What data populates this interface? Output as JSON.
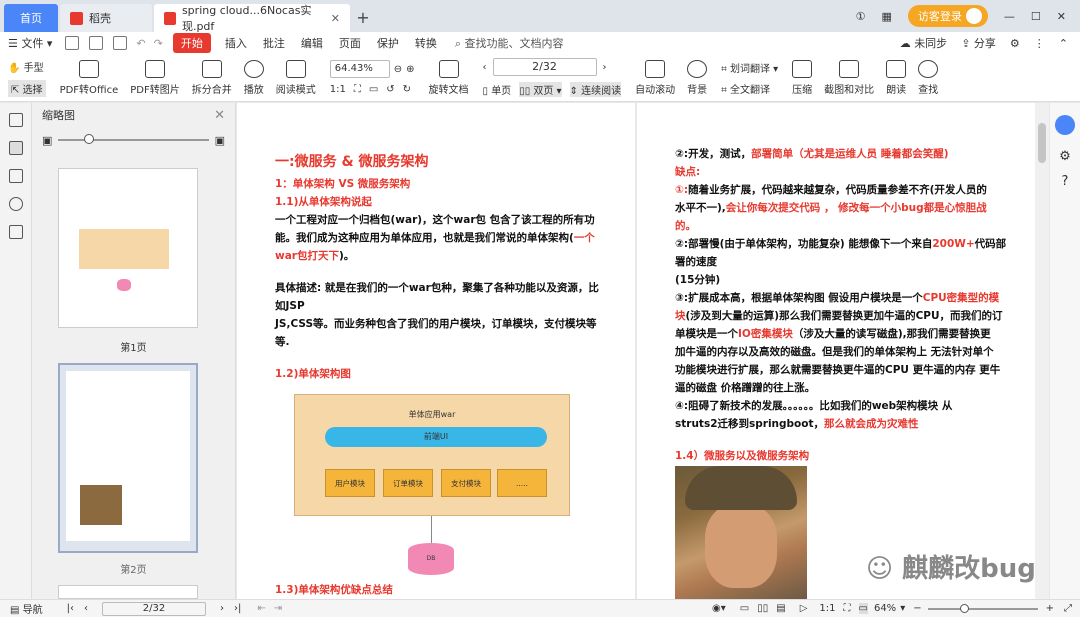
{
  "tabs": {
    "home": "首页",
    "dao": "稻壳",
    "doc": "spring cloud...6Nocas实现.pdf"
  },
  "titlebar": {
    "guest": "访客登录"
  },
  "menu": {
    "file": "文件",
    "start": "开始",
    "items": [
      "插入",
      "批注",
      "编辑",
      "页面",
      "保护",
      "转换"
    ],
    "search": "查找功能、文档内容",
    "sync": "未同步",
    "share": "分享"
  },
  "toolbar": {
    "hand": "手型",
    "select": "选择",
    "pdf2office": "PDF转Office",
    "pdf2img": "PDF转图片",
    "split": "拆分合并",
    "play": "播放",
    "read": "阅读模式",
    "zoom": "64.43%",
    "rotate": "旋转文档",
    "page": "2/32",
    "single": "单页",
    "double": "双页",
    "continuous": "连续阅读",
    "autoscroll": "自动滚动",
    "bg": "背景",
    "translate": "划词翻译",
    "fulltranslate": "全文翻译",
    "compress": "压缩",
    "screenshot": "截图和对比",
    "tts": "朗读",
    "find": "查找"
  },
  "thumbs": {
    "title": "缩略图",
    "p1": "第1页",
    "p2": "第2页"
  },
  "left": {
    "h1": "一:微服务 & 微服务架构",
    "h2": "1：单体架构 VS 微服务架构",
    "h3": "1.1)从单体架构说起",
    "p1a": "一个工程对应一个归档包(war)，这个war包  包含了该工程的所有功",
    "p1b": "能。我们成为这种应用为单体应用，也就是我们常说的单体架构(",
    "p1b_red": "一个",
    "p1c_red": "war包打天下",
    "p1c": ")。",
    "p2a": "具体描述: 就是在我们的一个war包种，聚集了各种功能以及资源，比",
    "p2b": "如JSP",
    "p2c": "JS,CSS等。而业务种包含了我们的用户模块，订单模块，支付模块等",
    "p2d": "等.",
    "h4": "1.2)单体架构图",
    "diag_title": "单体应用war",
    "diag_gw": "前端UI",
    "diag_mods": [
      "用户模块",
      "订单模块",
      "支付模块",
      "....."
    ],
    "diag_db": "DB",
    "h5": "1.3)单体架构优缺点总结"
  },
  "right": {
    "l1a": "②:开发，测试，",
    "l1b": "部署简单（尤其是运维人员 睡着都会笑醒)",
    "l2": "缺点:",
    "l3a": "①:",
    "l3b": "随着业务扩展，代码越来越复杂，代码质量参差不齐(开发人员的",
    "l4a": "水平不一),",
    "l4b": "会让你每次提交代码 ， 修改每一个小bug都是心惊胆战",
    "l5": "的。",
    "l6a": "②:部署慢(由于单体架构，功能复杂) 能想像下一个来自",
    "l6b": "200W+",
    "l6c": "代码部",
    "l7": "署的速度",
    "l8": "(15分钟)",
    "l9a": "③:扩展成本高，根据单体架构图  假设用户模块是一个",
    "l9b": "CPU密集型的模",
    "l10a": "块",
    "l10b": "(涉及到大量的运算)那么我们需要替换更加牛逼的CPU，而我们的订",
    "l11a": "单模块是一个",
    "l11b": "IO密集模块",
    "l11c": "（涉及大量的读写磁盘)",
    "l11d": ",那我们需要替换更",
    "l12": "加牛逼的内存以及高效的磁盘。但是我们的单体架构上 无法针对单个",
    "l13": "功能模块进行扩展，那么就需要替换更牛逼的CPU 更牛逼的内存 更牛",
    "l14": "逼的磁盘  价格蹭蹭的往上涨。",
    "l15": "④:阻碍了新技术的发展。。。。。。比如我们的web架构模块 从",
    "l16a": "struts2迁移到springboot，",
    "l16b": "那么就会成为灾难性",
    "h": "1.4）微服务以及微服务架构",
    "watermark": "麒麟改bug"
  },
  "status": {
    "nav": "导航",
    "page": "2/32",
    "zoom": "64%"
  }
}
